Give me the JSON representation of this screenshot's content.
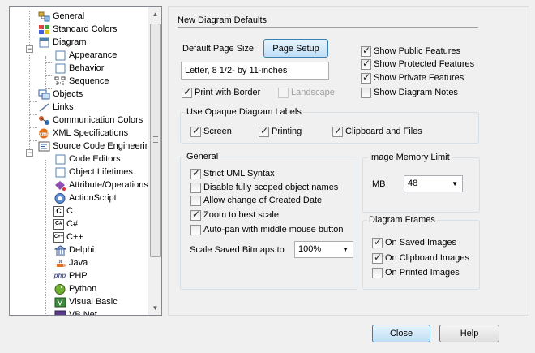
{
  "tree": {
    "items": [
      {
        "label": "General"
      },
      {
        "label": "Standard Colors"
      },
      {
        "label": "Diagram"
      },
      {
        "label": "Appearance"
      },
      {
        "label": "Behavior"
      },
      {
        "label": "Sequence"
      },
      {
        "label": "Objects"
      },
      {
        "label": "Links"
      },
      {
        "label": "Communication Colors"
      },
      {
        "label": "XML Specifications"
      },
      {
        "label": "Source Code Engineering"
      },
      {
        "label": "Code Editors"
      },
      {
        "label": "Object Lifetimes"
      },
      {
        "label": "Attribute/Operations"
      },
      {
        "label": "ActionScript"
      },
      {
        "label": "C"
      },
      {
        "label": "C#"
      },
      {
        "label": "C++"
      },
      {
        "label": "Delphi"
      },
      {
        "label": "Java"
      },
      {
        "label": "PHP"
      },
      {
        "label": "Python"
      },
      {
        "label": "Visual Basic"
      },
      {
        "label": "VB.Net"
      }
    ],
    "expander_open": "−",
    "icon_letters": {
      "c": "C",
      "csharp": "C#",
      "cpp": "C++",
      "php": "php"
    }
  },
  "panel": {
    "title": "New Diagram Defaults",
    "page_size_label": "Default Page Size:",
    "page_setup_button": "Page Setup",
    "page_size_value": "Letter, 8 1/2- by 11-inches",
    "print_with_border": {
      "label": "Print with Border",
      "checked": true
    },
    "landscape": {
      "label": "Landscape",
      "checked": false,
      "disabled": true
    },
    "show_public": {
      "label": "Show Public Features",
      "checked": true
    },
    "show_protected": {
      "label": "Show Protected Features",
      "checked": true
    },
    "show_private": {
      "label": "Show Private Features",
      "checked": true
    },
    "show_notes": {
      "label": "Show Diagram Notes",
      "checked": false
    },
    "opaque_group": {
      "legend": "Use Opaque Diagram Labels",
      "screen": {
        "label": "Screen",
        "checked": true
      },
      "printing": {
        "label": "Printing",
        "checked": true
      },
      "clipboard": {
        "label": "Clipboard and Files",
        "checked": true
      }
    },
    "general_group": {
      "legend": "General",
      "strict_uml": {
        "label": "Strict UML Syntax",
        "checked": true
      },
      "disable_scoped": {
        "label": "Disable fully scoped object names",
        "checked": false
      },
      "allow_change": {
        "label": "Allow change of Created Date",
        "checked": false
      },
      "zoom_best": {
        "label": "Zoom to best scale",
        "checked": true
      },
      "autopan": {
        "label": "Auto-pan with middle mouse button",
        "checked": false
      },
      "scale_label": "Scale Saved Bitmaps to",
      "scale_value": "100%"
    },
    "memory_group": {
      "legend": "Image Memory Limit",
      "mb_label": "MB",
      "mb_value": "48"
    },
    "frames_group": {
      "legend": "Diagram Frames",
      "on_saved": {
        "label": "On Saved Images",
        "checked": true
      },
      "on_clipboard": {
        "label": "On Clipboard Images",
        "checked": true
      },
      "on_printed": {
        "label": "On Printed Images",
        "checked": false
      }
    }
  },
  "footer": {
    "close_button": "Close",
    "help_button": "Help"
  },
  "colors": {
    "accent": "#3c7fb1",
    "panel_bg": "#f0f0f0"
  }
}
